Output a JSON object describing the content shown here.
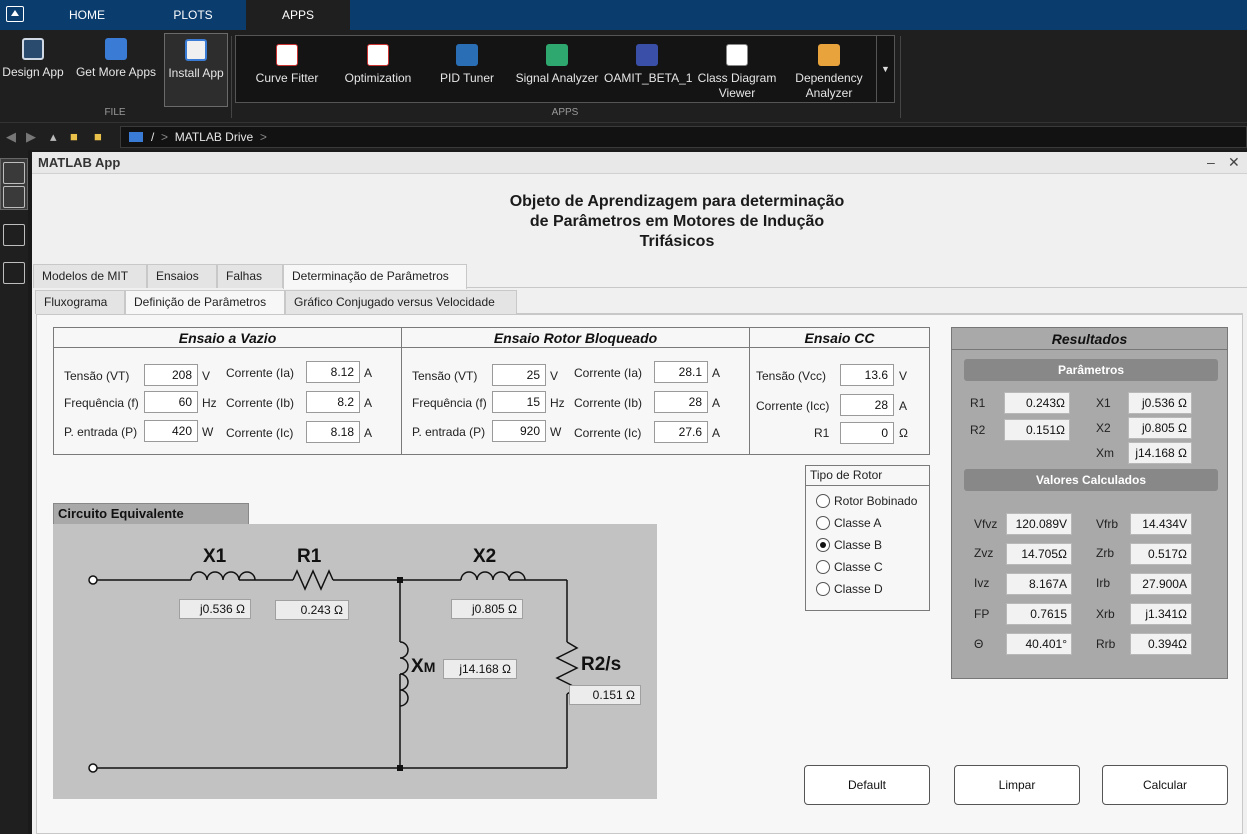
{
  "toolstrip": {
    "tabs": [
      "HOME",
      "PLOTS",
      "APPS"
    ],
    "file_buttons": [
      "Design App",
      "Get More Apps",
      "Install App"
    ],
    "file_group": "FILE",
    "apps": [
      "Curve Fitter",
      "Optimization",
      "PID Tuner",
      "Signal Analyzer",
      "OAMIT_BETA_1",
      "Class Diagram Viewer",
      "Dependency Analyzer"
    ],
    "apps_group": "APPS"
  },
  "address": {
    "root": "/",
    "sep": ">",
    "folder": "MATLAB Drive"
  },
  "window": {
    "title": "MATLAB App",
    "minimize": "–",
    "close": "✕"
  },
  "app": {
    "title_line1": "Objeto de Aprendizagem para determinação",
    "title_line2": "de Parâmetros em Motores de Indução",
    "title_line3": "Trifásicos",
    "main_tabs": [
      "Modelos de MIT",
      "Ensaios",
      "Falhas",
      "Determinação de Parâmetros"
    ],
    "sub_tabs": [
      "Fluxograma",
      "Definição de Parâmetros",
      "Gráfico Conjugado versus Velocidade"
    ]
  },
  "vazio": {
    "title": "Ensaio a Vazio",
    "tensao_label": "Tensão (VT)",
    "tensao": "208",
    "tensao_unit": "V",
    "freq_label": "Frequência (f)",
    "freq": "60",
    "freq_unit": "Hz",
    "pot_label": "P. entrada (P)",
    "pot": "420",
    "pot_unit": "W",
    "ia_label": "Corrente (Ia)",
    "ia": "8.12",
    "ib_label": "Corrente (Ib)",
    "ib": "8.2",
    "ic_label": "Corrente (Ic)",
    "ic": "8.18",
    "i_unit": "A"
  },
  "bloqueado": {
    "title": "Ensaio Rotor Bloqueado",
    "tensao_label": "Tensão (VT)",
    "tensao": "25",
    "tensao_unit": "V",
    "freq_label": "Frequência (f)",
    "freq": "15",
    "freq_unit": "Hz",
    "pot_label": "P. entrada (P)",
    "pot": "920",
    "pot_unit": "W",
    "ia_label": "Corrente (Ia)",
    "ia": "28.1",
    "ib_label": "Corrente (Ib)",
    "ib": "28",
    "ic_label": "Corrente (Ic)",
    "ic": "27.6",
    "i_unit": "A"
  },
  "cc": {
    "title": "Ensaio CC",
    "v_label": "Tensão (Vcc)",
    "v": "13.6",
    "v_unit": "V",
    "i_label": "Corrente (Icc)",
    "i": "28",
    "i_unit": "A",
    "r_label": "R1",
    "r": "0",
    "r_unit": "Ω"
  },
  "rotor": {
    "title": "Tipo de Rotor",
    "options": [
      "Rotor Bobinado",
      "Classe A",
      "Classe B",
      "Classe C",
      "Classe D"
    ],
    "selected": "Classe B"
  },
  "resultados": {
    "title": "Resultados",
    "parametros_title": "Parâmetros",
    "r1_label": "R1",
    "r1": "0.243Ω",
    "r2_label": "R2",
    "r2": "0.151Ω",
    "x1_label": "X1",
    "x1": "j0.536 Ω",
    "x2_label": "X2",
    "x2": "j0.805 Ω",
    "xm_label": "Xm",
    "xm": "j14.168 Ω",
    "calc_title": "Valores Calculados",
    "vfvz_label": "Vfvz",
    "vfvz": "120.089V",
    "zvz_label": "Zvz",
    "zvz": "14.705Ω",
    "ivz_label": "Ivz",
    "ivz": "8.167A",
    "fp_label": "FP",
    "fp": "0.7615",
    "theta_label": "Θ",
    "theta": "40.401°",
    "vfrb_label": "Vfrb",
    "vfrb": "14.434V",
    "zrb_label": "Zrb",
    "zrb": "0.517Ω",
    "irb_label": "Irb",
    "irb": "27.900A",
    "xrb_label": "Xrb",
    "xrb": "j1.341Ω",
    "rrb_label": "Rrb",
    "rrb": "0.394Ω"
  },
  "circuito": {
    "title": "Circuito Equivalente",
    "x1_label": "X1",
    "x1": "j0.536 Ω",
    "r1_label": "R1",
    "r1": "0.243 Ω",
    "x2_label": "X2",
    "x2": "j0.805 Ω",
    "xm_label_main": "X",
    "xm_label_sub": "M",
    "xm": "j14.168 Ω",
    "r2s_label": "R2/s",
    "r2s": "0.151 Ω"
  },
  "buttons": {
    "default": "Default",
    "limpar": "Limpar",
    "calcular": "Calcular"
  }
}
